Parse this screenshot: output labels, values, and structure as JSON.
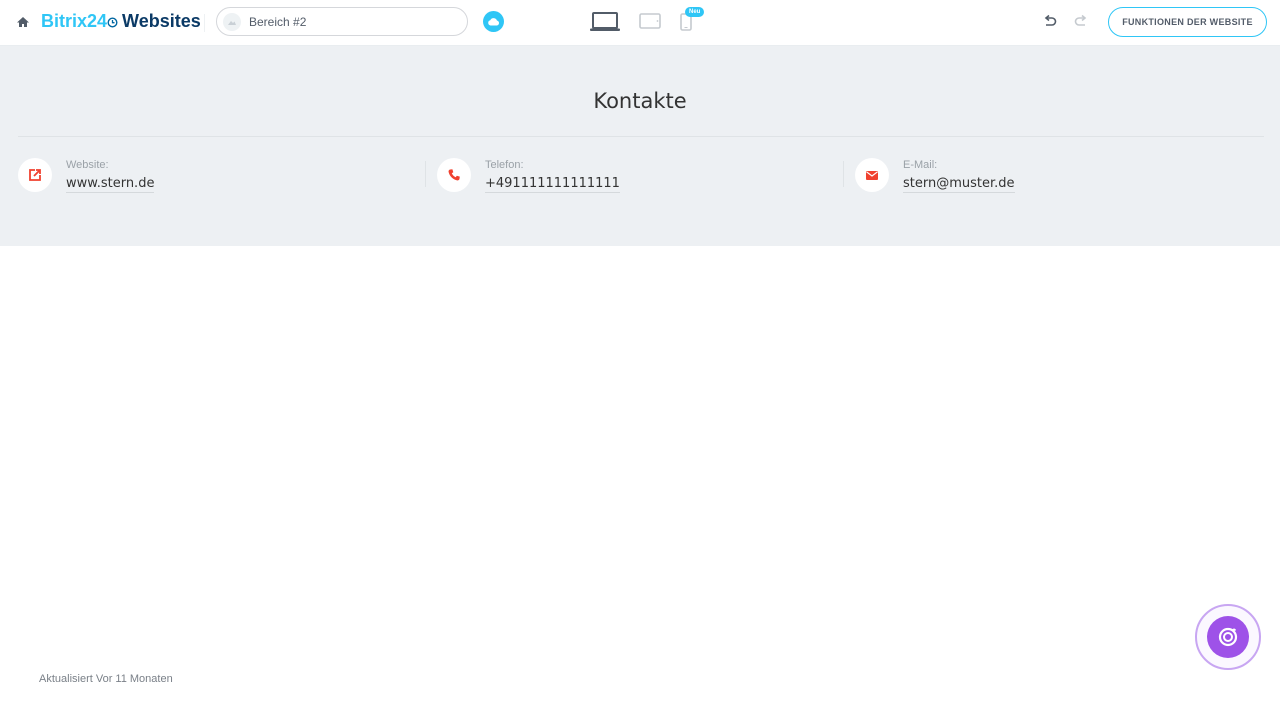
{
  "header": {
    "brand_part1": "Bitrix24",
    "brand_part2": "Websites",
    "site_name": "Bereich #2",
    "new_badge": "Neu",
    "features_button": "FUNKTIONEN DER WEBSITE"
  },
  "section": {
    "title": "Kontakte",
    "contacts": [
      {
        "label": "Website:",
        "value": "www.stern.de",
        "icon": "external-link-icon"
      },
      {
        "label": "Telefon:",
        "value": "+491111111111111",
        "icon": "phone-icon"
      },
      {
        "label": "E-Mail:",
        "value": "stern@muster.de",
        "icon": "envelope-icon"
      }
    ]
  },
  "footer": {
    "updated": "Aktualisiert Vor 11 Monaten"
  },
  "colors": {
    "accent": "#2fc6f6",
    "brand_dark": "#0066a1",
    "contact_icon": "#f0412f",
    "fab": "#9e52e8"
  }
}
